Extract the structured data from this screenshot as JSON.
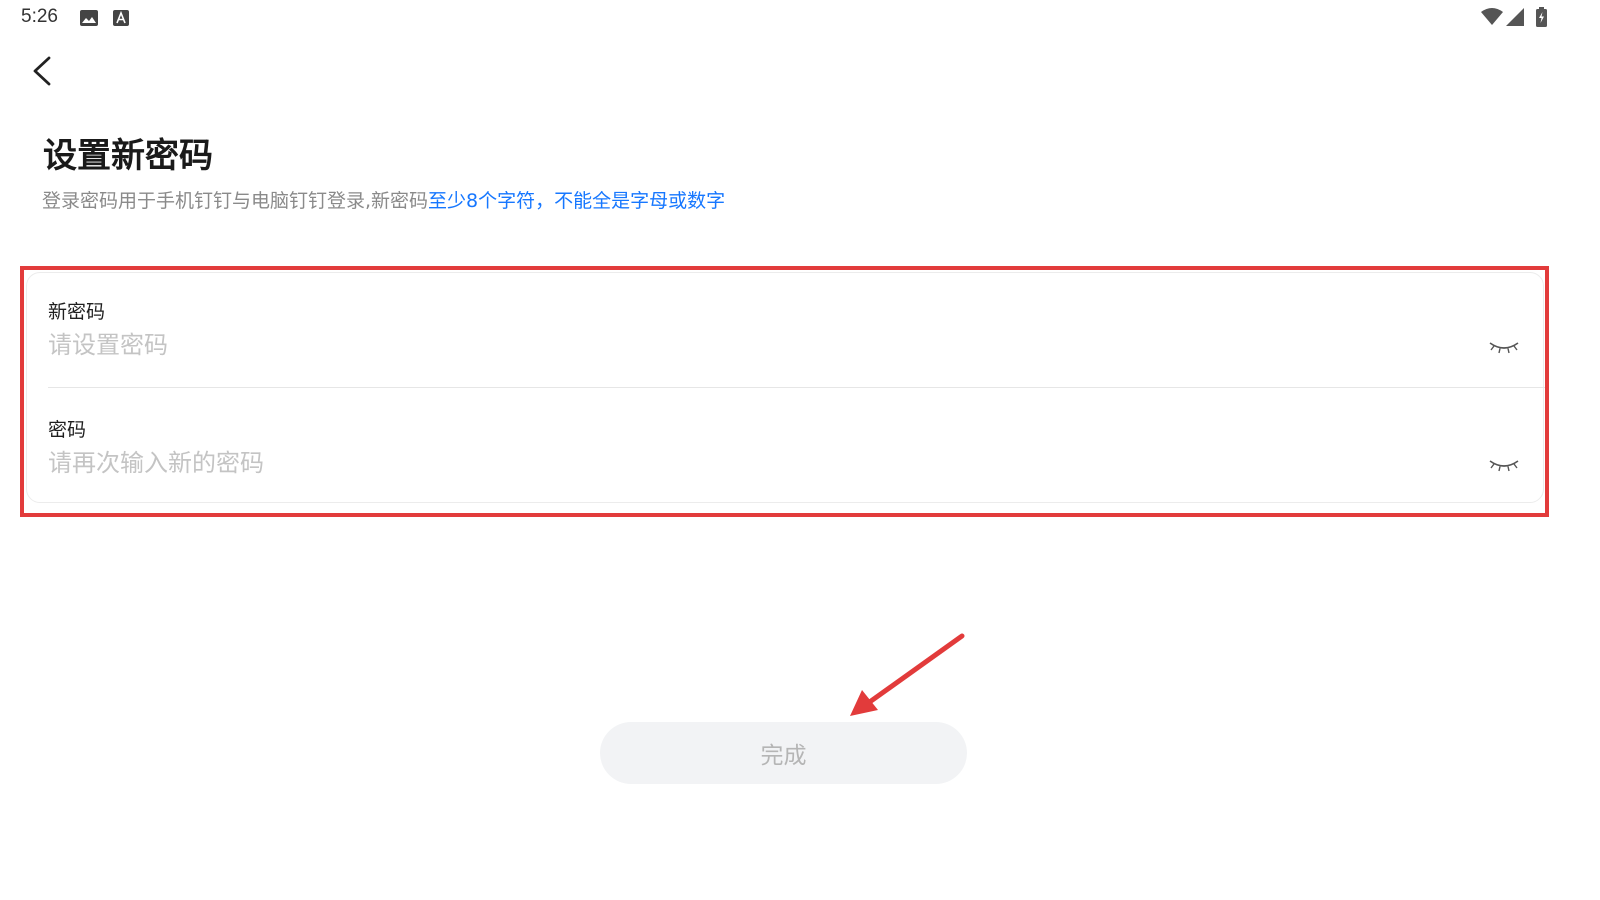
{
  "status_bar": {
    "time": "5:26",
    "left_icons": [
      "image-icon",
      "a-icon"
    ],
    "right_icons": [
      "wifi-icon",
      "signal-icon",
      "battery-charging-icon"
    ]
  },
  "header": {
    "back_icon": "chevron-left-icon",
    "title": "设置新密码",
    "subtitle_prefix": "登录密码用于手机钉钉与电脑钉钉登录,新密码",
    "subtitle_highlight": "至少8个字符，不能全是字母或数字"
  },
  "form": {
    "new_password": {
      "label": "新密码",
      "placeholder": "请设置密码",
      "toggle_icon": "eye-closed-icon"
    },
    "confirm_password": {
      "label": "密码",
      "placeholder": "请再次输入新的密码",
      "toggle_icon": "eye-closed-icon"
    }
  },
  "actions": {
    "done_label": "完成"
  },
  "colors": {
    "accent": "#1677ff",
    "annotation": "#e23b3b",
    "button_bg": "#f2f3f5",
    "placeholder": "#c4c4c4"
  }
}
